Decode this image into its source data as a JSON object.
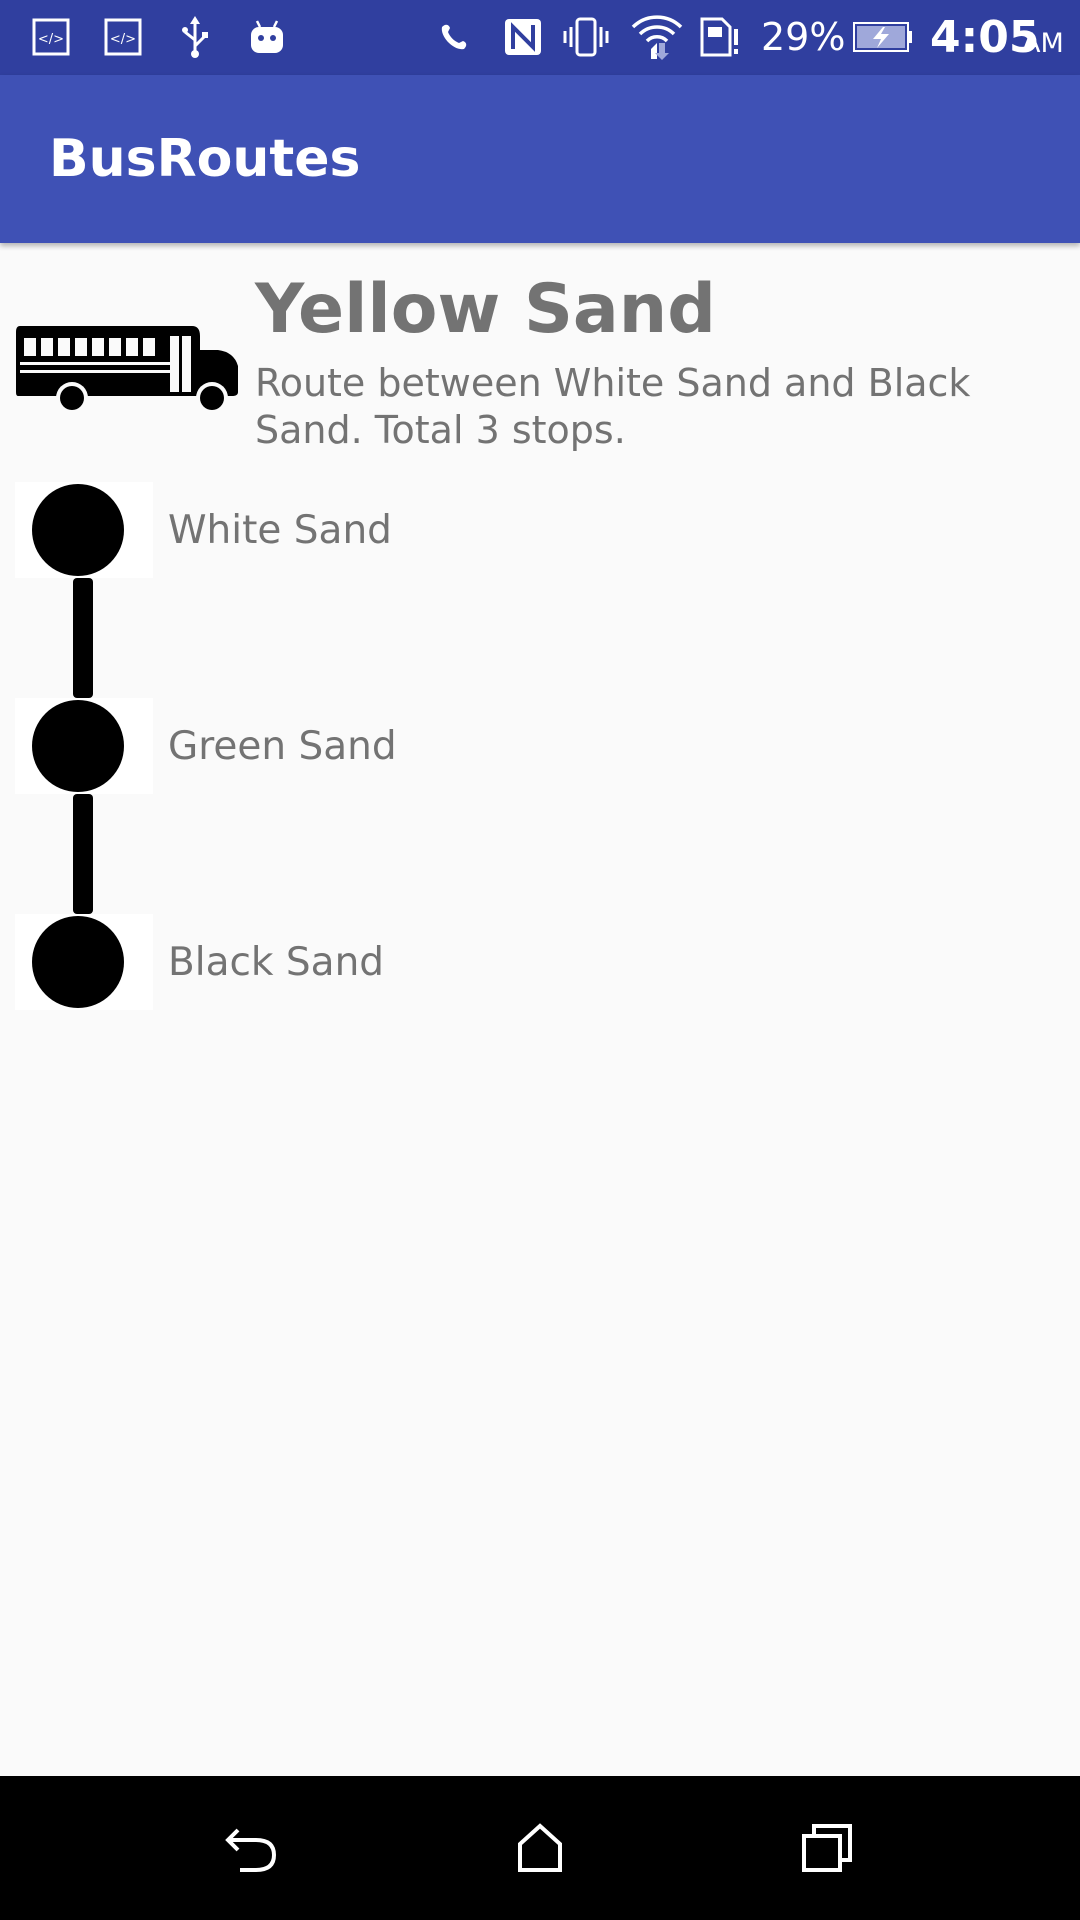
{
  "status_bar": {
    "battery_percent": "29%",
    "time": "4:05",
    "time_suffix": "AM",
    "icons": [
      "code-icon",
      "code-icon",
      "usb-icon",
      "android-icon",
      "phone-call-icon",
      "nfc-icon",
      "vibrate-icon",
      "wifi-icon",
      "sim-alert-icon",
      "battery-charging-icon"
    ],
    "background_color": "#303f9f"
  },
  "app_bar": {
    "title": "BusRoutes",
    "background_color": "#3f51b5"
  },
  "route": {
    "icon": "bus-icon",
    "name": "Yellow Sand",
    "description": "Route between White Sand and Black Sand. Total 3 stops."
  },
  "stops": [
    {
      "label": "White Sand"
    },
    {
      "label": "Green Sand"
    },
    {
      "label": "Black Sand"
    }
  ],
  "nav_bar": {
    "buttons": [
      "back-icon",
      "home-icon",
      "recents-icon"
    ]
  }
}
